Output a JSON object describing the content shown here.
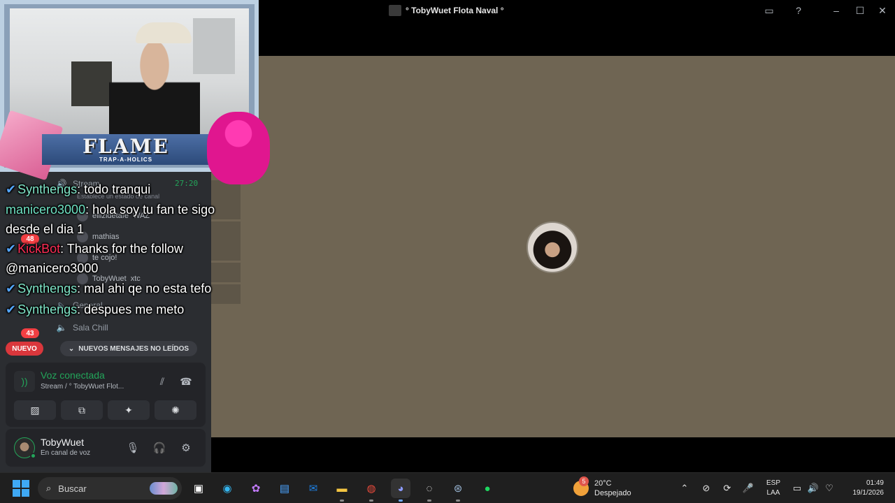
{
  "window": {
    "title": "° TobyWuet Flota Naval °"
  },
  "overlay": {
    "banner_text": "FLAME",
    "banner_sub": "TRAP-A-HOLICS",
    "chat": [
      {
        "user": "Synthengs",
        "color": "#7fe6c8",
        "verified": true,
        "message": ": todo tranqui"
      },
      {
        "user": "manicero3000",
        "color": "#6fe3c4",
        "verified": false,
        "message": ": hola soy tu fan te sigo desde el dia 1"
      },
      {
        "user": "KickBot",
        "color": "#ff2d55",
        "verified": true,
        "message": ": Thanks for the follow @manicero3000"
      },
      {
        "user": "Synthengs",
        "color": "#7fe6c8",
        "verified": true,
        "message": ": mal ahi qe no esta tefo"
      },
      {
        "user": "Synthengs",
        "color": "#7fe6c8",
        "verified": true,
        "message": ": despues me meto"
      }
    ]
  },
  "sidebar": {
    "stream_channel": "Stream",
    "stream_time": "27:20",
    "status_hint": "Establece un estado de canal",
    "members": [
      {
        "name": "ellizidetafe",
        "tag": "WAZ"
      },
      {
        "name": "mathias"
      },
      {
        "name": "te cojo!"
      },
      {
        "name": "TobyWuet",
        "tag": "xtc"
      }
    ],
    "channels": [
      {
        "name": "General"
      },
      {
        "name": "Sala Chill"
      }
    ],
    "rail_badges": [
      "48",
      "43"
    ],
    "new_badge": "NUEVO",
    "unread_label": "NUEVOS MENSAJES NO LEÍDOS"
  },
  "voice": {
    "title": "Voz conectada",
    "subtitle": "Stream / ° TobyWuet Flot..."
  },
  "user": {
    "name": "TobyWuet",
    "status": "En canal de voz"
  },
  "taskbar": {
    "search_placeholder": "Buscar",
    "weather_badge": "5",
    "temperature": "20°C",
    "weather_desc": "Despejado",
    "lang_top": "ESP",
    "lang_bottom": "LAA",
    "time": "01:49",
    "date": "19/1/2026"
  },
  "colors": {
    "stage_bg": "#6f6553",
    "sidebar_bg": "#2b2d31",
    "voice_green": "#23a55a",
    "taskbar_bg": "#1f1f1f"
  }
}
